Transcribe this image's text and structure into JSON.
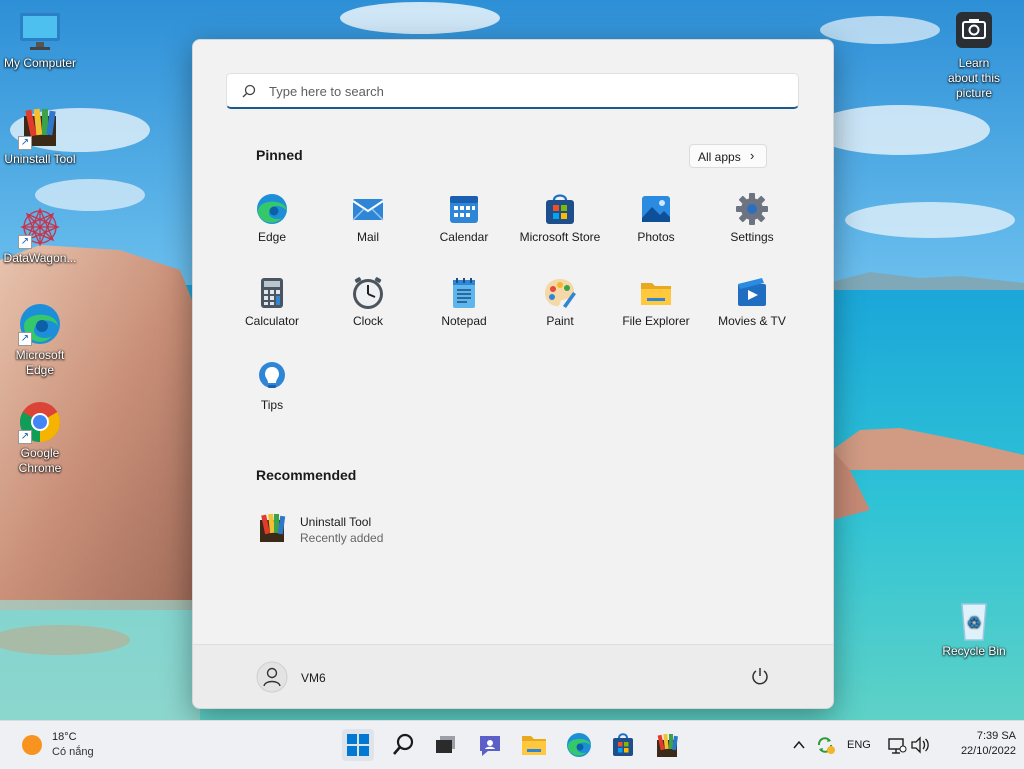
{
  "desktop": {
    "icons": [
      {
        "label": "My Computer"
      },
      {
        "label": "Uninstall Tool"
      },
      {
        "label": "DataWagon..."
      },
      {
        "label": "Microsoft Edge"
      },
      {
        "label": "Google Chrome"
      },
      {
        "label": "Learn about this picture"
      },
      {
        "label": "Recycle Bin"
      }
    ]
  },
  "start_menu": {
    "search_placeholder": "Type here to search",
    "pinned_title": "Pinned",
    "all_apps_label": "All apps",
    "all_apps_chevron": "›",
    "pinned": [
      {
        "label": "Edge",
        "icon": "edge-icon"
      },
      {
        "label": "Mail",
        "icon": "mail-icon"
      },
      {
        "label": "Calendar",
        "icon": "calendar-icon"
      },
      {
        "label": "Microsoft Store",
        "icon": "store-icon"
      },
      {
        "label": "Photos",
        "icon": "photos-icon"
      },
      {
        "label": "Settings",
        "icon": "gear-icon"
      },
      {
        "label": "Calculator",
        "icon": "calculator-icon"
      },
      {
        "label": "Clock",
        "icon": "clock-icon"
      },
      {
        "label": "Notepad",
        "icon": "notepad-icon"
      },
      {
        "label": "Paint",
        "icon": "paint-icon"
      },
      {
        "label": "File Explorer",
        "icon": "folder-icon"
      },
      {
        "label": "Movies & TV",
        "icon": "movies-icon"
      },
      {
        "label": "Tips",
        "icon": "tips-icon"
      }
    ],
    "recommended_title": "Recommended",
    "recommended": [
      {
        "title": "Uninstall Tool",
        "subtitle": "Recently added"
      }
    ],
    "user_name": "VM6"
  },
  "taskbar": {
    "weather_temp": "18°C",
    "weather_desc": "Có nắng",
    "language": "ENG",
    "time": "7:39 SA",
    "date": "22/10/2022"
  },
  "colors": {
    "accent": "#0067c0",
    "search_underline": "#1a5b8c",
    "menu_bg": "#f2f2f2"
  }
}
